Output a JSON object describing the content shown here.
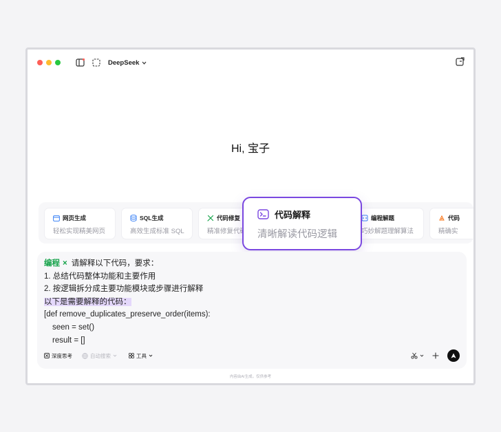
{
  "app": {
    "name": "DeepSeek"
  },
  "greeting": "Hi, 宝子",
  "cards": [
    {
      "title": "网页生成",
      "subtitle": "轻松实现精美网页",
      "icon": "window-icon",
      "color": "#3b82f6"
    },
    {
      "title": "SQL生成",
      "subtitle": "高效生成标准 SQL",
      "icon": "database-icon",
      "color": "#3b82f6"
    },
    {
      "title": "代码修复",
      "subtitle": "精准修复代码",
      "icon": "wrench-icon",
      "color": "#16a34a"
    },
    {
      "title": "编程解题",
      "subtitle": "巧妙解题理解算法",
      "icon": "puzzle-icon",
      "color": "#3b82f6"
    },
    {
      "title": "代码",
      "subtitle": "精确实",
      "icon": "code-icon",
      "color": "#f97316"
    }
  ],
  "popup": {
    "title": "代码解释",
    "subtitle": "清晰解读代码逻辑",
    "icon": "terminal-icon",
    "border_color": "#7a47e0"
  },
  "composer": {
    "tag": "编程",
    "tag_close": "×",
    "lines": [
      "请解释以下代码，要求：",
      "1. 总结代码整体功能和主要作用",
      "2. 按逻辑拆分成主要功能模块或步骤进行解释",
      "以下是需要解释的代码：",
      "[def remove_duplicates_preserve_order(items):",
      "seen = set()",
      "result = []"
    ],
    "tools": {
      "deep_think": "深度思考",
      "auto_search": "自动搜索",
      "tools_label": "工具"
    }
  },
  "footer": "内容由AI生成，仅供参考"
}
